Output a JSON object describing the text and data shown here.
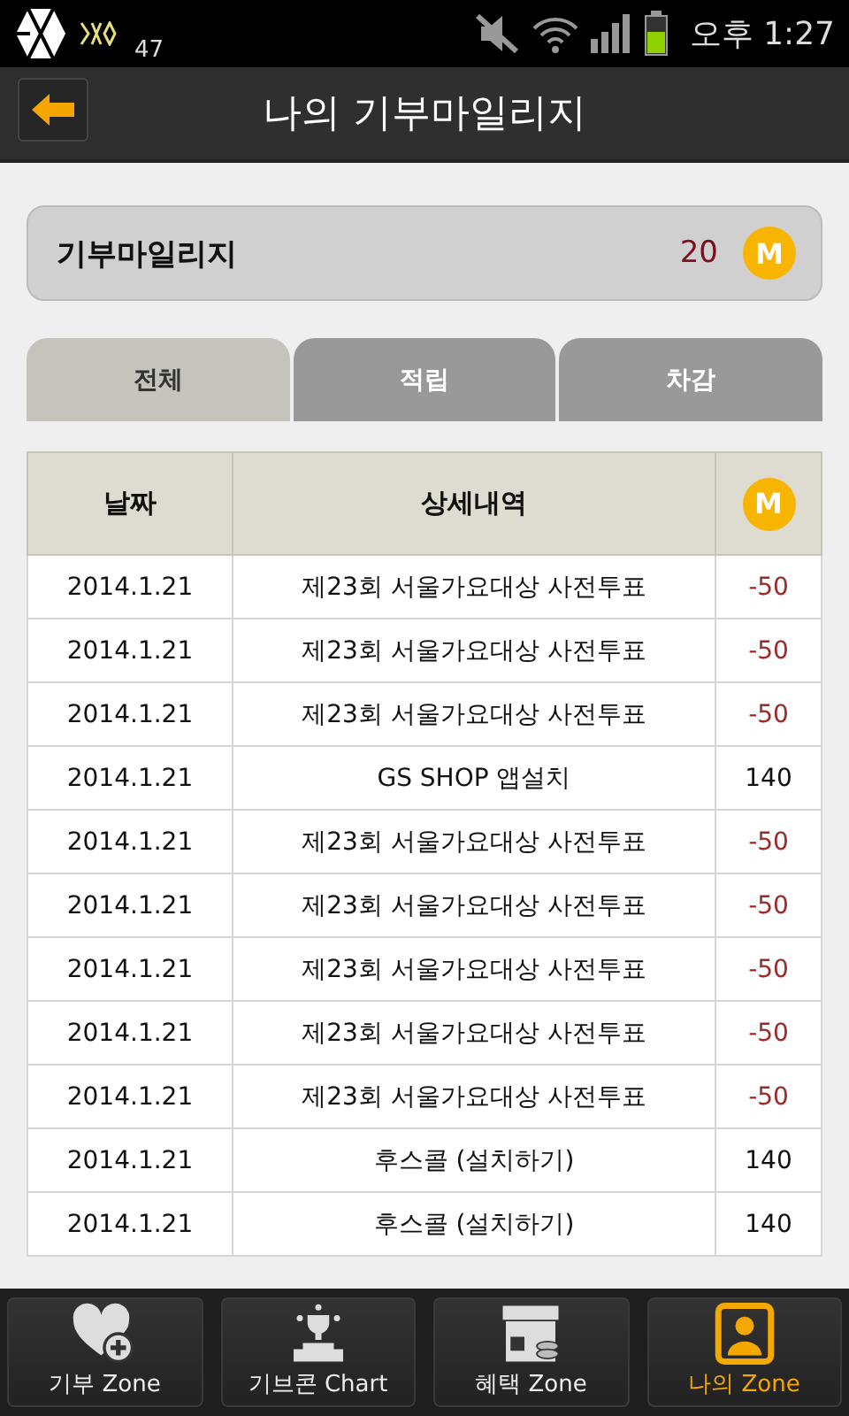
{
  "status_bar": {
    "app_badge": "47",
    "time": "오후 1:27"
  },
  "header": {
    "title": "나의 기부마일리지"
  },
  "mileage": {
    "label": "기부마일리지",
    "value": "20",
    "coin": "M"
  },
  "tabs": [
    {
      "label": "전체",
      "selected": true
    },
    {
      "label": "적립",
      "selected": false
    },
    {
      "label": "차감",
      "selected": false
    }
  ],
  "table": {
    "columns": [
      "날짜",
      "상세내역"
    ],
    "coin_column": "M",
    "rows": [
      {
        "date": "2014.1.21",
        "detail": "제23회 서울가요대상 사전투표",
        "amount": "-50",
        "kind": "minus"
      },
      {
        "date": "2014.1.21",
        "detail": "제23회 서울가요대상 사전투표",
        "amount": "-50",
        "kind": "minus"
      },
      {
        "date": "2014.1.21",
        "detail": "제23회 서울가요대상 사전투표",
        "amount": "-50",
        "kind": "minus"
      },
      {
        "date": "2014.1.21",
        "detail": "GS SHOP 앱설치",
        "amount": "140",
        "kind": "plus"
      },
      {
        "date": "2014.1.21",
        "detail": "제23회 서울가요대상 사전투표",
        "amount": "-50",
        "kind": "minus"
      },
      {
        "date": "2014.1.21",
        "detail": "제23회 서울가요대상 사전투표",
        "amount": "-50",
        "kind": "minus"
      },
      {
        "date": "2014.1.21",
        "detail": "제23회 서울가요대상 사전투표",
        "amount": "-50",
        "kind": "minus"
      },
      {
        "date": "2014.1.21",
        "detail": "제23회 서울가요대상 사전투표",
        "amount": "-50",
        "kind": "minus"
      },
      {
        "date": "2014.1.21",
        "detail": "제23회 서울가요대상 사전투표",
        "amount": "-50",
        "kind": "minus"
      },
      {
        "date": "2014.1.21",
        "detail": "후스콜 (설치하기)",
        "amount": "140",
        "kind": "plus"
      },
      {
        "date": "2014.1.21",
        "detail": "후스콜 (설치하기)",
        "amount": "140",
        "kind": "plus"
      }
    ]
  },
  "nav": [
    {
      "label": "기부 Zone",
      "kind": "donate",
      "selected": false
    },
    {
      "label": "기브콘 Chart",
      "kind": "chart",
      "selected": false
    },
    {
      "label": "혜택 Zone",
      "kind": "benefit",
      "selected": false
    },
    {
      "label": "나의 Zone",
      "kind": "my",
      "selected": true
    }
  ]
}
